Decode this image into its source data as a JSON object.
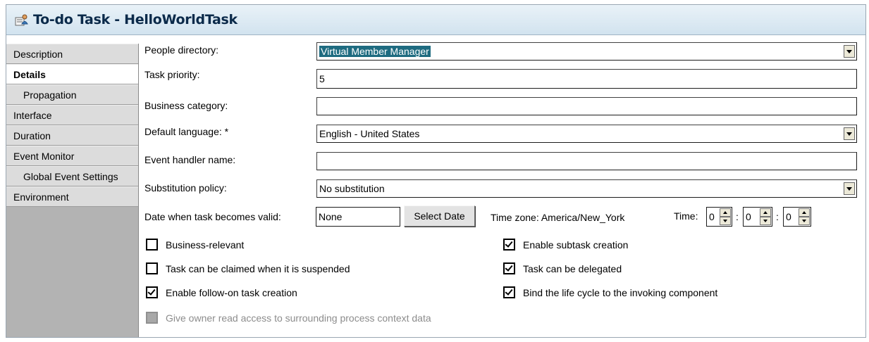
{
  "window": {
    "title": "To-do Task - HelloWorldTask"
  },
  "sidebar": {
    "items": [
      {
        "label": "Description"
      },
      {
        "label": "Details"
      },
      {
        "label": "Propagation"
      },
      {
        "label": "Interface"
      },
      {
        "label": "Duration"
      },
      {
        "label": "Event Monitor"
      },
      {
        "label": "Global Event Settings"
      },
      {
        "label": "Environment"
      }
    ],
    "active": "Details"
  },
  "form": {
    "people_directory": {
      "label": "People directory:",
      "value": "Virtual Member Manager"
    },
    "task_priority": {
      "label": "Task priority:",
      "value": "5"
    },
    "business_category": {
      "label": "Business category:",
      "value": ""
    },
    "default_language": {
      "label": "Default language: *",
      "value": "English - United States"
    },
    "event_handler_name": {
      "label": "Event handler name:",
      "value": ""
    },
    "substitution_policy": {
      "label": "Substitution policy:",
      "value": "No substitution"
    },
    "valid_date": {
      "label": "Date when task becomes valid:",
      "value": "None",
      "button": "Select Date"
    },
    "time_zone": {
      "text": "Time zone: America/New_York"
    },
    "time": {
      "label": "Time:",
      "hours": "0",
      "minutes": "0",
      "seconds": "0",
      "separator": ":"
    }
  },
  "checkboxes": {
    "business_relevant": {
      "label": "Business-relevant",
      "checked": false
    },
    "claim_suspended": {
      "label": "Task can be claimed when it is suspended",
      "checked": false
    },
    "follow_on": {
      "label": "Enable follow-on task creation",
      "checked": true
    },
    "owner_read_access": {
      "label": "Give owner read access to surrounding process context data",
      "checked": false,
      "disabled": true
    },
    "subtask_creation": {
      "label": "Enable subtask creation",
      "checked": true
    },
    "delegated": {
      "label": "Task can be delegated",
      "checked": true
    },
    "bind_lifecycle": {
      "label": "Bind the life cycle to the invoking component",
      "checked": true
    }
  },
  "colors": {
    "title_text": "#0b2a4a",
    "title_bg": "#d2e3ef",
    "sidebar_bg": "#b3b3b3",
    "selection": "#1e6b80"
  }
}
